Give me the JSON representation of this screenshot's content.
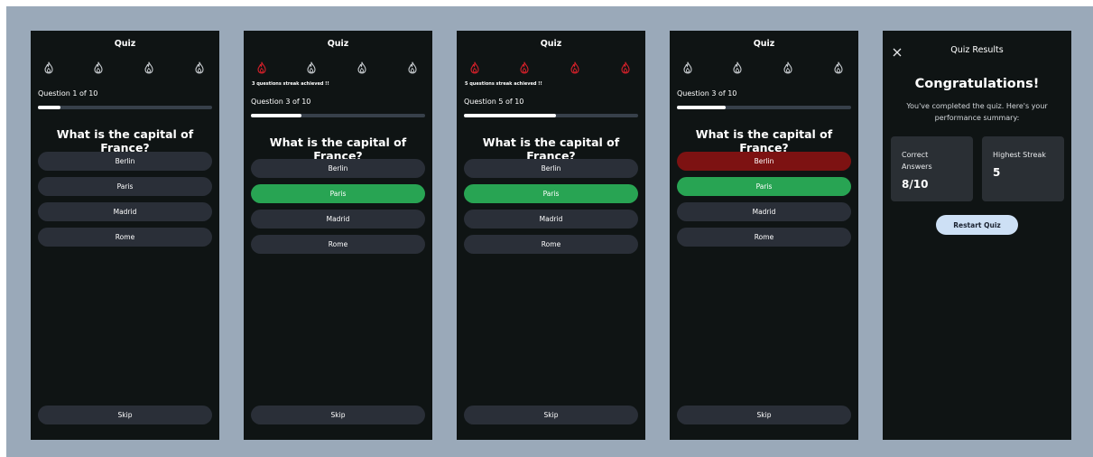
{
  "screens": [
    {
      "title": "Quiz",
      "flames": [
        "off",
        "off",
        "off",
        "off"
      ],
      "streak_message": "",
      "question_count": "Question 1 of 10",
      "progress": 0.13,
      "question": "What is the capital of France?",
      "options": [
        {
          "label": "Berlin",
          "state": "default"
        },
        {
          "label": "Paris",
          "state": "default"
        },
        {
          "label": "Madrid",
          "state": "default"
        },
        {
          "label": "Rome",
          "state": "default"
        }
      ],
      "skip_label": "Skip"
    },
    {
      "title": "Quiz",
      "flames": [
        "on",
        "off",
        "off",
        "off"
      ],
      "streak_message": "3 questions streak achieved !!",
      "question_count": "Question 3 of 10",
      "progress": 0.29,
      "question": "What is the capital of France?",
      "options": [
        {
          "label": "Berlin",
          "state": "default"
        },
        {
          "label": "Paris",
          "state": "correct"
        },
        {
          "label": "Madrid",
          "state": "default"
        },
        {
          "label": "Rome",
          "state": "default"
        }
      ],
      "skip_label": "Skip"
    },
    {
      "title": "Quiz",
      "flames": [
        "on",
        "on",
        "on",
        "on"
      ],
      "streak_message": "5 questions streak achieved !!",
      "question_count": "Question 5 of 10",
      "progress": 0.53,
      "question": "What is the capital of France?",
      "options": [
        {
          "label": "Berlin",
          "state": "default"
        },
        {
          "label": "Paris",
          "state": "correct"
        },
        {
          "label": "Madrid",
          "state": "default"
        },
        {
          "label": "Rome",
          "state": "default"
        }
      ],
      "skip_label": "Skip"
    },
    {
      "title": "Quiz",
      "flames": [
        "off",
        "off",
        "off",
        "off"
      ],
      "streak_message": "",
      "question_count": "Question 3 of 10",
      "progress": 0.28,
      "question": "What is the capital of France?",
      "options": [
        {
          "label": "Berlin",
          "state": "wrong"
        },
        {
          "label": "Paris",
          "state": "correct"
        },
        {
          "label": "Madrid",
          "state": "default"
        },
        {
          "label": "Rome",
          "state": "default"
        }
      ],
      "skip_label": "Skip"
    }
  ],
  "results": {
    "title": "Quiz Results",
    "congrats": "Congratulations!",
    "summary": "You've completed the quiz. Here's your performance summary:",
    "correct_label": "Correct Answers",
    "correct_value": "8/10",
    "streak_label": "Highest Streak",
    "streak_value": "5",
    "restart_label": "Restart Quiz"
  },
  "colors": {
    "canvas": "#9aa9b9",
    "screen_bg": "#0f1414",
    "option_bg": "#2a2f38",
    "correct": "#28a453",
    "wrong": "#7d1212",
    "flame_on": "#d6202a",
    "flame_off": "#c8ccd0",
    "restart_bg": "#cde0f5"
  },
  "icons": {
    "flame": "flame-icon",
    "close": "close-icon"
  }
}
